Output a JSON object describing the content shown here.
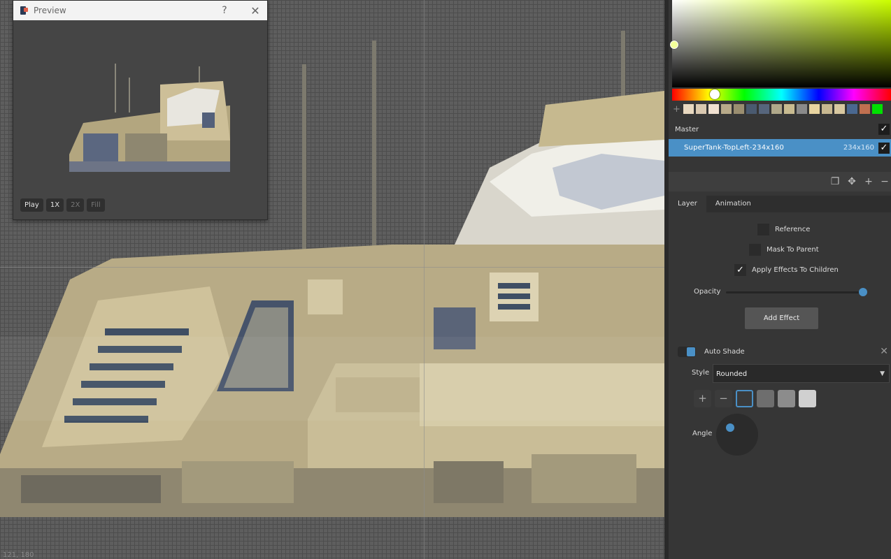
{
  "preview": {
    "title": "Preview",
    "help": "?",
    "close": "✕",
    "buttons": {
      "play": "Play",
      "x1": "1X",
      "x2": "2X",
      "fill": "Fill"
    }
  },
  "canvas": {
    "coords": "121, 180"
  },
  "colors": {
    "accent": "#4a90c6",
    "swatches": [
      "#e8d8c0",
      "#d9c8b0",
      "#f0e0d0",
      "#b8aa8a",
      "#9a8e70",
      "#4a5a70",
      "#56657c",
      "#b0a88a",
      "#c8bb90",
      "#8a8a8a",
      "#e8d4a0",
      "#c8b890",
      "#d8c8a0",
      "#4a6890",
      "#c07050",
      "#00e000"
    ]
  },
  "layers": {
    "master": "Master",
    "selected_name": "SuperTank-TopLeft-234x160",
    "selected_size": "234x160"
  },
  "tabs": {
    "layer": "Layer",
    "animation": "Animation"
  },
  "options": {
    "reference": "Reference",
    "mask_to_parent": "Mask To Parent",
    "apply_effects": "Apply Effects To Children",
    "opacity": "Opacity",
    "opacity_value": 1.0,
    "add_effect": "Add Effect"
  },
  "effect": {
    "name": "Auto Shade",
    "style_label": "Style",
    "style_value": "Rounded",
    "angle_label": "Angle",
    "shade_swatches": [
      "#3a3a3a",
      "#6e6e6e",
      "#8c8c8c",
      "#d0d0d0"
    ]
  }
}
